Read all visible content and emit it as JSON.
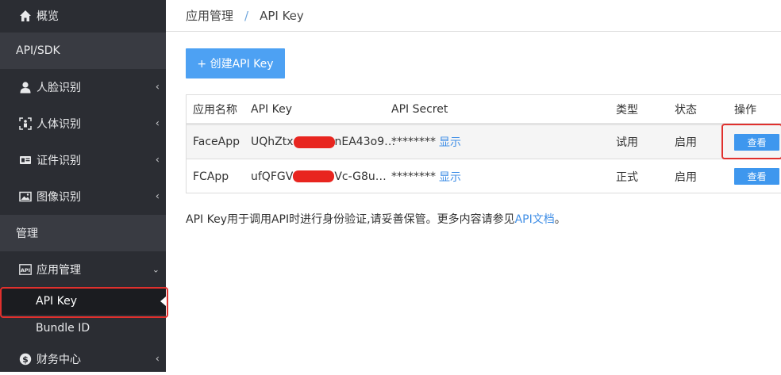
{
  "sidebar": {
    "overview": "概览",
    "section_api": "API/SDK",
    "face": "人脸识别",
    "body": "人体识别",
    "idcard": "证件识别",
    "image": "图像识别",
    "section_manage": "管理",
    "app_manage": "应用管理",
    "api_key": "API Key",
    "bundle_id": "Bundle ID",
    "finance": "财务中心"
  },
  "breadcrumb": {
    "parent": "应用管理",
    "separator": "/",
    "current": "API Key"
  },
  "create_button": "+ 创建API Key",
  "table": {
    "headers": [
      "应用名称",
      "API Key",
      "API Secret",
      "类型",
      "状态",
      "操作"
    ],
    "rows": [
      {
        "name": "FaceApp",
        "key_prefix": "UQhZtx",
        "key_suffix": "nEA43o9…",
        "secret": "********",
        "show": "显示",
        "type": "试用",
        "status": "启用",
        "action": "查看"
      },
      {
        "name": "FCApp",
        "key_prefix": "ufQFGV",
        "key_suffix": "Vc-G8u…",
        "secret": "********",
        "show": "显示",
        "type": "正式",
        "status": "启用",
        "action": "查看"
      }
    ]
  },
  "note": {
    "text": "API Key用于调用API时进行身份验证,请妥善保管。更多内容请参见",
    "link": "API文档",
    "end": "。"
  },
  "colors": {
    "sidebar_bg": "#2b2d33",
    "section_bg": "#393b42",
    "accent": "#4da1f3",
    "link": "#3f8ee6",
    "highlight": "#e0302d"
  }
}
